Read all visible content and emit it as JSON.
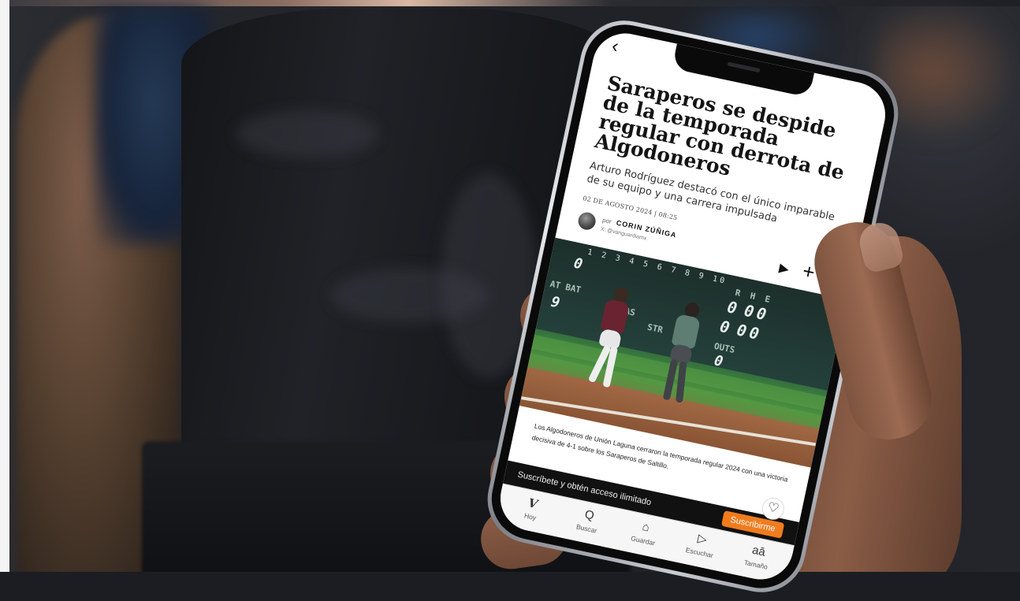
{
  "article": {
    "headline": "Saraperos se despide de la temporada regular con derrota de Algodoneros",
    "subheadline": "Arturo Rodríguez destacó con el único imparable de su equipo y una carrera impulsada",
    "date": "02 DE AGOSTO 2024 | 08:25",
    "byline_prefix": "por",
    "author": "CORIN ZÚÑIGA",
    "author_handle": "X: @vanguardiamx",
    "body": "Los Algodoneros de Unión Laguna cerraron la temporada regular 2024 con una victoria decisiva de 4-1 sobre los Saraperos de Saltillo."
  },
  "scoreboard": {
    "innings": "1 2 3 4 5 6 7 8 9 10",
    "rhe": "R  H  E",
    "at_bat_label": "AT BAT",
    "outs_label": "OUTS",
    "balls_label": "BOLAS",
    "strikes_label": "STR",
    "values": {
      "first": "0",
      "at_bat": "9",
      "bolas": "0",
      "r": "0",
      "h": "0",
      "e": "0",
      "r2": "0",
      "h2": "0",
      "e2": "0",
      "outs": "0"
    }
  },
  "subscribe": {
    "text": "Suscríbete y obtén acceso ilimitado",
    "button": "Suscribirme"
  },
  "tabs": [
    {
      "icon": "V",
      "label": "Hoy"
    },
    {
      "icon": "Q",
      "label": "Buscar"
    },
    {
      "icon": "⌂",
      "label": "Guardar"
    },
    {
      "icon": "▷",
      "label": "Escuchar"
    },
    {
      "icon": "aā",
      "label": "Tamaño"
    }
  ],
  "icons": {
    "back": "‹",
    "play": "▶",
    "plus": "+",
    "heart": "♡"
  },
  "colors": {
    "accent": "#f07c1e"
  }
}
